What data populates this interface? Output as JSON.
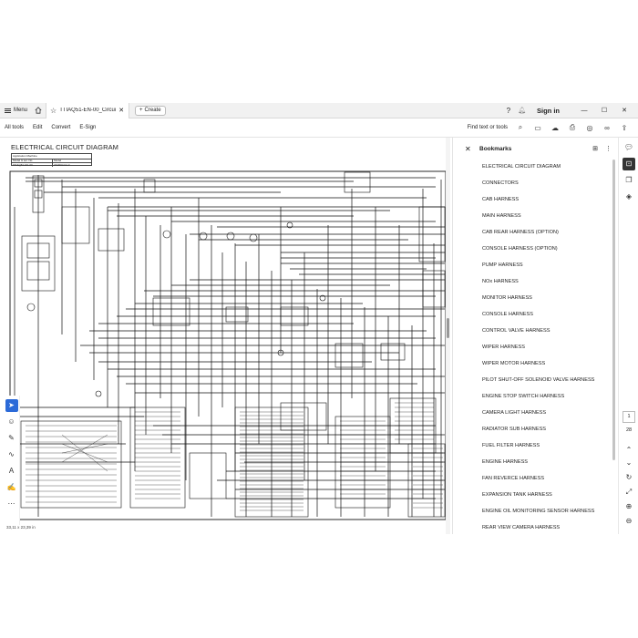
{
  "tabbar": {
    "menu_label": "Menu",
    "doc_tab_title": "TTIAQ51-EN-00_Circuit(...",
    "create_label": "Create",
    "signin_label": "Sign in",
    "icons": [
      "hamburger-icon",
      "home-icon",
      "star-icon",
      "close-icon",
      "plus-icon",
      "help-icon",
      "bell-icon",
      "minimize-icon",
      "maximize-icon",
      "close-window-icon"
    ]
  },
  "toolbar": {
    "all_tools": "All tools",
    "edit": "Edit",
    "convert": "Convert",
    "esign": "E-Sign",
    "find_text": "Find text or tools",
    "icons": [
      "search-icon",
      "save-icon",
      "upload-icon",
      "print-icon",
      "ai-assistant-icon",
      "link-icon",
      "share-icon"
    ]
  },
  "document": {
    "page_header": "ELECTRICAL CIRCUIT DIAGRAM",
    "model_box": {
      "row1_label": "Application Machine",
      "row2_left": "Model & ser. No.",
      "row2_right": "Model",
      "row3_left": "TTIAQ51-EN-00",
      "row3_right": "ZX200LCH-7"
    },
    "page_size": "33,11 x 23,39 in"
  },
  "bookmarks": {
    "title": "Bookmarks",
    "items": [
      "ELECTRICAL CIRCUIT DIAGRAM",
      "CONNECTORS",
      "CAB HARNESS",
      "MAIN HARNESS",
      "CAB REAR HARNESS (OPTION)",
      "CONSOLE HARNESS (OPTION)",
      "PUMP HARNESS",
      "NOx HARNESS",
      "MONITOR HARNESS",
      "CONSOLE HARNESS",
      "CONTROL VALVE HARNESS",
      "WIPER HARNESS",
      "WIPER MOTOR HARNESS",
      "PILOT SHUT-OFF SOLENOID VALVE HARNESS",
      "ENGINE STOP SWITCH HARNESS",
      "CAMERA LIGHT HARNESS",
      "RADIATOR SUB HARNESS",
      "FUEL FILTER HARNESS",
      "ENGINE HARNESS",
      "FAN REVERCE HARNESS",
      "EXPANSION TANK HARNESS",
      "ENGINE OIL MONITORING SENSOR HARNESS",
      "REAR VIEW CAMERA HARNESS"
    ]
  },
  "rail": {
    "page_current": "1",
    "page_total": "28"
  },
  "colors": {
    "accent": "#2b6ad8",
    "tabbar_bg": "#f1f1f1",
    "line": "#111111"
  }
}
